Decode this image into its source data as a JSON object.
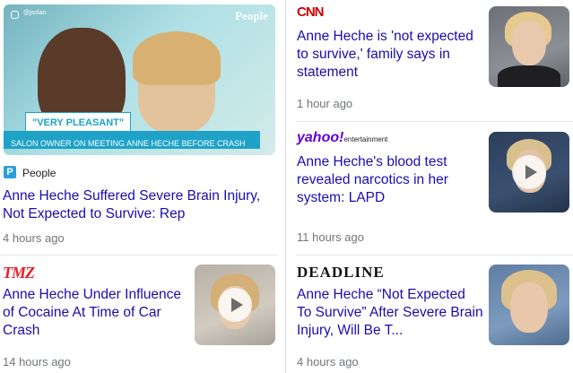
{
  "cards": [
    {
      "source": "People",
      "headline": "Anne Heche Suffered Severe Brain Injury, Not Expected to Survive: Rep",
      "time": "4 hours ago",
      "video": {
        "watermark": "People",
        "handle": "@jsolan",
        "banner_title": "\"VERY PLEASANT\"",
        "banner_subtitle": "SALON OWNER ON MEETING ANNE HECHE BEFORE CRASH"
      }
    },
    {
      "source": "CNN",
      "headline": "Anne Heche is 'not expected to survive,' family says in statement",
      "time": "1 hour ago"
    },
    {
      "source_main": "yahoo!",
      "source_sub": "entertainment",
      "headline": "Anne Heche's blood test revealed narcotics in her system: LAPD",
      "time": "11 hours ago"
    },
    {
      "source": "TMZ",
      "headline": "Anne Heche Under Influence of Cocaine At Time of Car Crash",
      "time": "14 hours ago"
    },
    {
      "source": "DEADLINE",
      "headline": "Anne Heche “Not Expected To Survive” After Severe Brain Injury, Will Be T...",
      "time": "4 hours ago"
    }
  ],
  "colors": {
    "link": "#1a0dab",
    "meta": "#70757a",
    "cnn": "#cc0000",
    "yahoo": "#6001d2",
    "tmz": "#e8202a",
    "people_badge": "#2d9ed8",
    "banner": "#1ea2c7"
  }
}
